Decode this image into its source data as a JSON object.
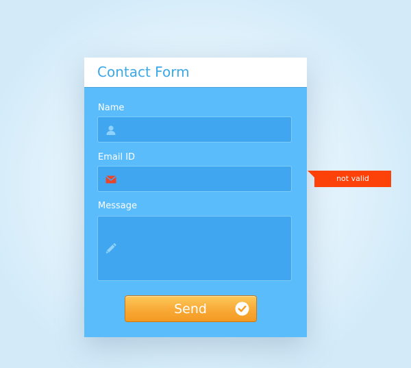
{
  "form": {
    "title": "Contact Form",
    "fields": {
      "name": {
        "label": "Name",
        "value": "",
        "icon": "user-icon"
      },
      "email": {
        "label": "Email ID",
        "value": "",
        "icon": "envelope-icon",
        "icon_color": "#e8452c"
      },
      "message": {
        "label": "Message",
        "value": "",
        "icon": "pencil-icon"
      }
    },
    "error_tooltip": "not valid",
    "send_label": "Send",
    "send_icon": "check-circle-icon"
  },
  "colors": {
    "card": "#5bbcfb",
    "field": "#3fa6ef",
    "title": "#3aa8e8",
    "error": "#fc4109",
    "button": "#f8a936"
  }
}
